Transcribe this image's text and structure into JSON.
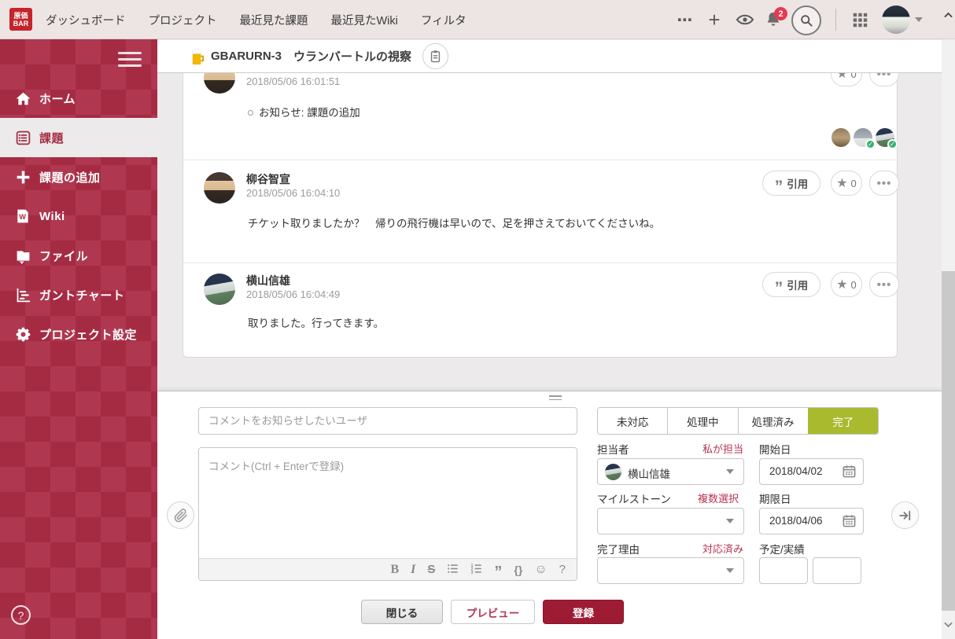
{
  "colors": {
    "brand_red": "#A52B43",
    "sidebar_checker_light": "#AF3850",
    "topbar_bg": "#EDE4E4",
    "status_selected_green": "#A9BA2E",
    "link_red": "#B8334F",
    "submit_button_red": "#9D1C34",
    "notification_badge_red": "#E8384F"
  },
  "topbar": {
    "logo_line1": "原価",
    "logo_line2": "BAR",
    "nav": [
      "ダッシュボード",
      "プロジェクト",
      "最近見た課題",
      "最近見たWiki",
      "フィルタ"
    ],
    "notification_count": "2"
  },
  "sidebar": {
    "items": [
      {
        "label": "ホーム"
      },
      {
        "label": "課題"
      },
      {
        "label": "課題の追加"
      },
      {
        "label": "Wiki"
      },
      {
        "label": "ファイル"
      },
      {
        "label": "ガントチャート"
      },
      {
        "label": "プロジェクト設定"
      }
    ],
    "help": "?"
  },
  "header": {
    "issue_key": "GBARURN-3",
    "title": "ウランバートルの視察"
  },
  "actions": {
    "quote_label": "引用"
  },
  "comments": [
    {
      "timestamp": "2018/05/06 16:01:51",
      "body": "お知らせ: 課題の追加",
      "stars": "0"
    },
    {
      "author": "柳谷智宣",
      "timestamp": "2018/05/06 16:04:10",
      "body": "チケット取りましたか？　帰りの飛行機は早いので、足を押さえておいてくださいね。",
      "stars": "0"
    },
    {
      "author": "横山信雄",
      "timestamp": "2018/05/06 16:04:49",
      "body": "取りました。行ってきます。",
      "stars": "0"
    }
  ],
  "form": {
    "notify_placeholder": "コメントをお知らせしたいユーザ",
    "comment_placeholder": "コメント(Ctrl + Enterで登録)",
    "statuses": [
      {
        "label": "未対応",
        "selected": false
      },
      {
        "label": "処理中",
        "selected": false
      },
      {
        "label": "処理済み",
        "selected": false
      },
      {
        "label": "完了",
        "selected": true
      }
    ],
    "assignee": {
      "label": "担当者",
      "link": "私が担当",
      "value": "横山信雄"
    },
    "start_date": {
      "label": "開始日",
      "value": "2018/04/02"
    },
    "milestone": {
      "label": "マイルストーン",
      "link": "複数選択",
      "value": ""
    },
    "due_date": {
      "label": "期限日",
      "value": "2018/04/06"
    },
    "reason": {
      "label": "完了理由",
      "link": "対応済み",
      "value": ""
    },
    "estimate": {
      "label": "予定/実績",
      "planned": "",
      "actual": ""
    },
    "editor": {
      "bold": "B",
      "italic": "I",
      "strike": "S",
      "braces": "{}",
      "question": "?"
    },
    "buttons": {
      "close": "閉じる",
      "preview": "プレビュー",
      "submit": "登録"
    }
  }
}
